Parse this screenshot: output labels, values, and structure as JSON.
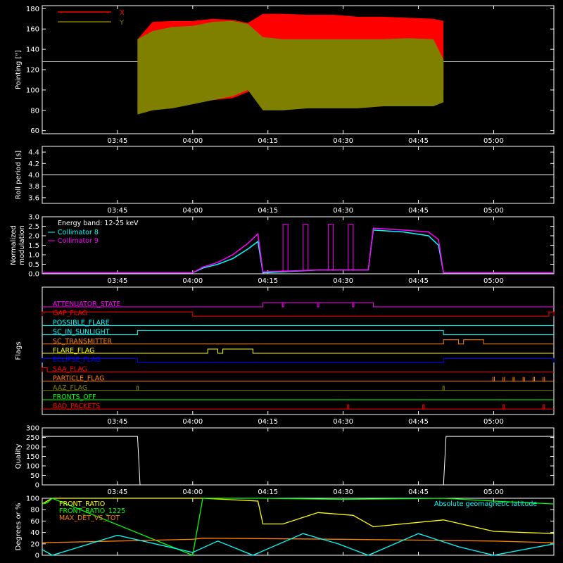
{
  "time_ticks": [
    "03:45",
    "04:00",
    "04:15",
    "04:30",
    "04:45",
    "05:00"
  ],
  "chart_data": [
    {
      "id": "pointing",
      "type": "line",
      "title": "",
      "xlabel": "",
      "ylabel": "Pointing [\"]",
      "ylim": [
        57,
        183
      ],
      "yticks": [
        "60",
        "80",
        "100",
        "120",
        "140",
        "160",
        "180"
      ],
      "reference_line": 128,
      "series": [
        {
          "name": "X",
          "color": "#ff0000",
          "x": [
            "03:49",
            "03:52",
            "03:56",
            "04:00",
            "04:04",
            "04:08",
            "04:11",
            "04:14",
            "04:18",
            "04:23",
            "04:28",
            "04:33",
            "04:38",
            "04:43",
            "04:48",
            "04:50"
          ],
          "upper": [
            150,
            167,
            168,
            168,
            170,
            169,
            166,
            175,
            175,
            174,
            174,
            172,
            172,
            171,
            170,
            168
          ],
          "lower": [
            78,
            80,
            84,
            88,
            90,
            92,
            98,
            110,
            114,
            115,
            114,
            114,
            113,
            112,
            112,
            100
          ]
        },
        {
          "name": "Y",
          "color": "#808000",
          "x": [
            "03:49",
            "03:52",
            "03:56",
            "04:00",
            "04:04",
            "04:08",
            "04:11",
            "04:14",
            "04:18",
            "04:23",
            "04:28",
            "04:33",
            "04:38",
            "04:43",
            "04:48",
            "04:50"
          ],
          "upper": [
            150,
            158,
            162,
            163,
            167,
            168,
            165,
            152,
            150,
            150,
            150,
            150,
            150,
            151,
            150,
            130
          ],
          "lower": [
            76,
            80,
            82,
            86,
            90,
            94,
            100,
            80,
            80,
            82,
            82,
            82,
            84,
            84,
            84,
            88
          ]
        }
      ]
    },
    {
      "id": "roll",
      "type": "line",
      "ylabel": "Roll period [s]",
      "ylim": [
        3.5,
        4.5
      ],
      "yticks": [
        "3.6",
        "3.8",
        "4.0",
        "4.2",
        "4.4"
      ],
      "series": [
        {
          "name": "",
          "color": "#ffffff",
          "x": [
            "03:30",
            "05:12"
          ],
          "y": [
            4.0,
            4.0
          ]
        }
      ]
    },
    {
      "id": "modulation",
      "type": "line",
      "ylabel": "Normalized modulation",
      "ylim": [
        0,
        3.0
      ],
      "yticks": [
        "0.0",
        "0.5",
        "1.0",
        "1.5",
        "2.0",
        "2.5",
        "3.0"
      ],
      "legend_title": "Energy band: 12-25 keV",
      "series": [
        {
          "name": "Collimator 8",
          "color": "#00ffff",
          "x": [
            "03:30",
            "04:00",
            "04:02",
            "04:05",
            "04:08",
            "04:11",
            "04:13",
            "04:14",
            "04:25",
            "04:35",
            "04:36",
            "04:42",
            "04:47",
            "04:49",
            "04:50",
            "05:12"
          ],
          "y": [
            0.05,
            0.05,
            0.3,
            0.5,
            0.8,
            1.3,
            1.7,
            0.05,
            0.2,
            0.2,
            2.3,
            2.2,
            2.0,
            1.5,
            0.05,
            0.05
          ]
        },
        {
          "name": "Collimator 9",
          "color": "#ff00ff",
          "x": [
            "03:30",
            "04:00",
            "04:02",
            "04:05",
            "04:08",
            "04:11",
            "04:13",
            "04:14",
            "04:25",
            "04:35",
            "04:36",
            "04:42",
            "04:47",
            "04:49",
            "04:50",
            "05:12"
          ],
          "y": [
            0.05,
            0.05,
            0.35,
            0.6,
            1.0,
            1.6,
            2.1,
            0.1,
            0.2,
            0.2,
            2.4,
            2.3,
            2.2,
            1.8,
            0.05,
            0.05
          ]
        }
      ]
    },
    {
      "id": "flags",
      "type": "line",
      "ylabel": "Flags",
      "rows": [
        {
          "name": "ATTENUATOR_STATE",
          "color": "#ff00ff",
          "high": [
            [
              "04:14",
              "04:36"
            ]
          ],
          "pulses": [
            "04:18",
            "04:25",
            "04:32"
          ],
          "pulse_dir": "down"
        },
        {
          "name": "GAP_FLAG",
          "color": "#ff0000",
          "high": [
            [
              "03:30",
              "04:00"
            ],
            [
              "05:11",
              "05:12"
            ]
          ]
        },
        {
          "name": "POSSIBLE_FLARE",
          "color": "#00ffff",
          "high": []
        },
        {
          "name": "SC_IN_SUNLIGHT",
          "color": "#00ffff",
          "high": [
            [
              "03:49",
              "04:50"
            ]
          ]
        },
        {
          "name": "SC_TRANSMITTER",
          "color": "#ff8000",
          "high": [
            [
              "04:50",
              "04:53"
            ],
            [
              "04:54",
              "04:58"
            ]
          ]
        },
        {
          "name": "FLARE_FLAG",
          "color": "#ffff00",
          "high": [
            [
              "04:03",
              "04:05"
            ],
            [
              "04:06",
              "04:12"
            ]
          ]
        },
        {
          "name": "ECLIPSE_FLAG",
          "color": "#0000ff",
          "high": [
            [
              "03:30",
              "03:49"
            ],
            [
              "04:50",
              "05:12"
            ]
          ]
        },
        {
          "name": "SAA_FLAG",
          "color": "#ff0000",
          "high": [
            [
              "03:30",
              "03:31"
            ]
          ]
        },
        {
          "name": "PARTICLE_FLAG",
          "color": "#ff8000",
          "high": [],
          "pulses": [
            "05:00",
            "05:02",
            "05:04",
            "05:06",
            "05:08",
            "05:10"
          ],
          "pulse_dir": "down"
        },
        {
          "name": "AAZ_FLAG",
          "color": "#808000",
          "high": [],
          "pulses": [
            "03:49",
            "04:50"
          ],
          "pulse_dir": "up"
        },
        {
          "name": "FRONTS_OFF",
          "color": "#00ff00",
          "high": []
        },
        {
          "name": "BAD_PACKETS",
          "color": "#ff0000",
          "high": [],
          "pulses": [
            "04:31",
            "04:46",
            "05:02",
            "05:10"
          ],
          "pulse_dir": "up"
        }
      ]
    },
    {
      "id": "quality",
      "type": "line",
      "ylabel": "Quality",
      "ylim": [
        0,
        300
      ],
      "yticks": [
        "0",
        "50",
        "100",
        "150",
        "200",
        "250",
        "300"
      ],
      "series": [
        {
          "name": "",
          "color": "#ffffff",
          "x": [
            "03:30",
            "03:49",
            "03:49.5",
            "04:50",
            "04:50.5",
            "05:12"
          ],
          "y": [
            255,
            255,
            0,
            0,
            255,
            255
          ]
        }
      ]
    },
    {
      "id": "ratios",
      "type": "line",
      "ylabel": "Degrees or %",
      "ylim": [
        0,
        100
      ],
      "yticks": [
        "0",
        "20",
        "40",
        "60",
        "80",
        "100"
      ],
      "annotation": {
        "text": "Absolute geomagnetic latitude",
        "color": "#00ffff"
      },
      "series": [
        {
          "name": "FRONT_RATIO",
          "color": "#ffff00",
          "x": [
            "03:30",
            "03:31",
            "03:32",
            "04:00",
            "04:02",
            "04:13",
            "04:14",
            "04:18",
            "04:25",
            "04:32",
            "04:36",
            "04:50",
            "04:51",
            "05:00",
            "05:12"
          ],
          "y": [
            90,
            95,
            100,
            100,
            100,
            95,
            55,
            55,
            75,
            70,
            50,
            62,
            60,
            42,
            38
          ]
        },
        {
          "name": "FRONT_RATIO_1225",
          "color": "#00ff00",
          "x": [
            "03:30",
            "03:31",
            "03:32",
            "04:00",
            "04:02",
            "04:14",
            "04:30",
            "04:50",
            "05:00",
            "05:12"
          ],
          "y": [
            90,
            92,
            100,
            0,
            100,
            100,
            98,
            100,
            95,
            90
          ]
        },
        {
          "name": "MAX_DET_VS_TOT",
          "color": "#ff8000",
          "x": [
            "03:30",
            "04:00",
            "04:02",
            "04:30",
            "05:00",
            "05:12"
          ],
          "y": [
            22,
            28,
            30,
            28,
            25,
            22
          ]
        },
        {
          "name": "",
          "color": "#00ffff",
          "x": [
            "03:30",
            "03:32",
            "03:45",
            "04:00",
            "04:05",
            "04:12",
            "04:22",
            "04:29",
            "04:35",
            "04:45",
            "04:53",
            "05:00",
            "05:12"
          ],
          "y": [
            10,
            0,
            35,
            5,
            25,
            0,
            38,
            20,
            0,
            38,
            15,
            0,
            20
          ]
        }
      ]
    }
  ]
}
